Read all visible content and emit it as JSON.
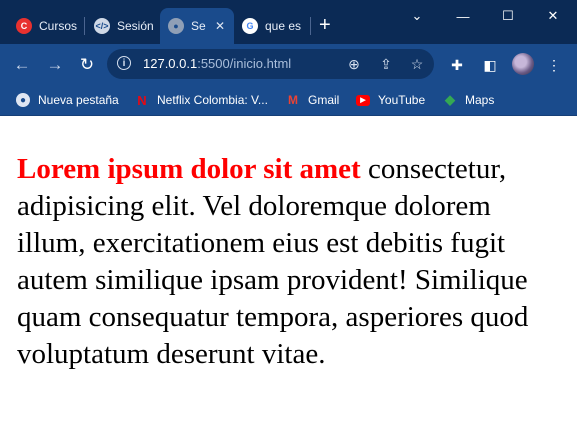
{
  "browser": {
    "tabs": [
      {
        "title": "Cursos",
        "icon": "brand-circle-icon",
        "color": "#e8312f"
      },
      {
        "title": "Sesión",
        "icon": "code-icon",
        "color": "#cfd8e6"
      },
      {
        "title": "Se",
        "icon": "globe-icon",
        "color": "#8f9fb6",
        "active": true
      },
      {
        "title": "que es",
        "icon": "google-icon",
        "color": "#ffffff"
      }
    ],
    "new_tab_label": "+",
    "window_controls": {
      "minimize": "—",
      "maximize": "☐",
      "close": "✕",
      "tab_search": "⌄"
    },
    "address": {
      "host": "127.0.0.1",
      "rest": ":5500/inicio.html"
    },
    "bookmarks": [
      {
        "label": "Nueva pestaña",
        "icon": "globe-icon"
      },
      {
        "label": "Netflix Colombia: V...",
        "icon": "netflix-icon",
        "glyph": "N",
        "color": "#e50914"
      },
      {
        "label": "Gmail",
        "icon": "gmail-icon",
        "glyph": "M",
        "color": "#ea4335"
      },
      {
        "label": "YouTube",
        "icon": "youtube-icon",
        "glyph": "▶",
        "color": "#ff0000"
      },
      {
        "label": "Maps",
        "icon": "maps-icon",
        "glyph": "◆",
        "color": "#34a853"
      }
    ]
  },
  "content": {
    "lead": "Lorem ipsum dolor sit amet",
    "body": "consectetur, adipisicing elit. Vel doloremque dolorem illum, exercitationem eius est debitis fugit autem similique ipsam provident! Similique quam consequatur tempora, asperiores quod voluptatum deserunt vitae.",
    "lead_color": "#ff0000"
  }
}
